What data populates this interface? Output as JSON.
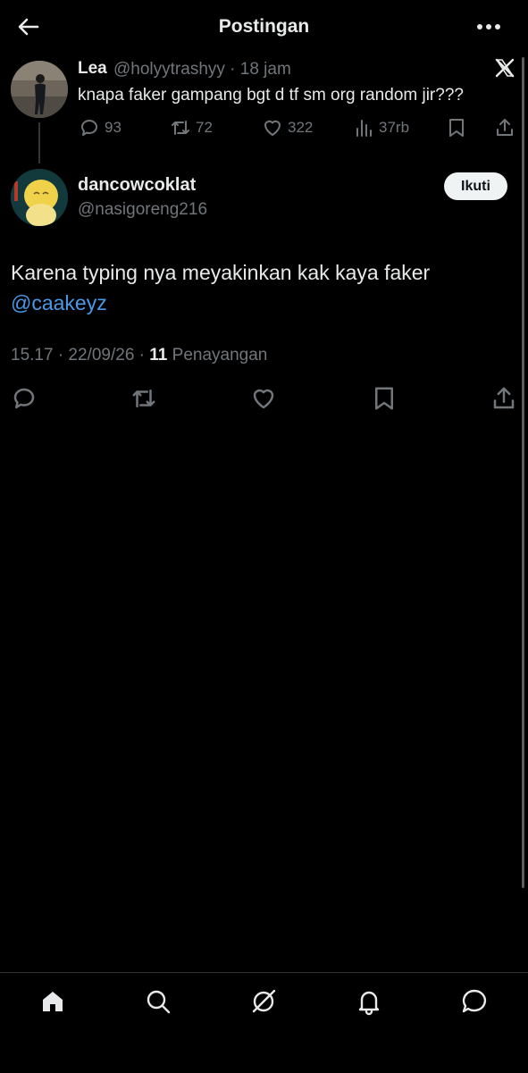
{
  "header": {
    "title": "Postingan"
  },
  "parent_tweet": {
    "name": "Lea",
    "handle_time": "@holyytrashyy · 18 jam",
    "text": "knapa faker gampang bgt d tf sm org random jir???",
    "replies": "93",
    "reposts": "72",
    "likes": "322",
    "views": "37rb"
  },
  "main_tweet": {
    "name": "dancowcoklat",
    "handle": "@nasigoreng216",
    "follow_label": "Ikuti",
    "text": "Karena typing nya meyakinkan kak kaya faker",
    "mention": "@caakeyz",
    "timestamp": "15.17 · 22/09/26 · ",
    "views_count": "11",
    "views_label": " Penayangan"
  },
  "colors": {
    "background": "#000000",
    "text": "#e7e9ea",
    "muted": "#71767b",
    "link": "#4a99e9",
    "follow_bg": "#eff3f4"
  },
  "icons": [
    "back-arrow-icon",
    "more-icon",
    "x-logo-icon",
    "reply-icon",
    "repost-icon",
    "like-icon",
    "views-icon",
    "bookmark-icon",
    "share-icon",
    "home-icon",
    "search-icon",
    "grok-icon",
    "notifications-icon",
    "messages-icon"
  ]
}
